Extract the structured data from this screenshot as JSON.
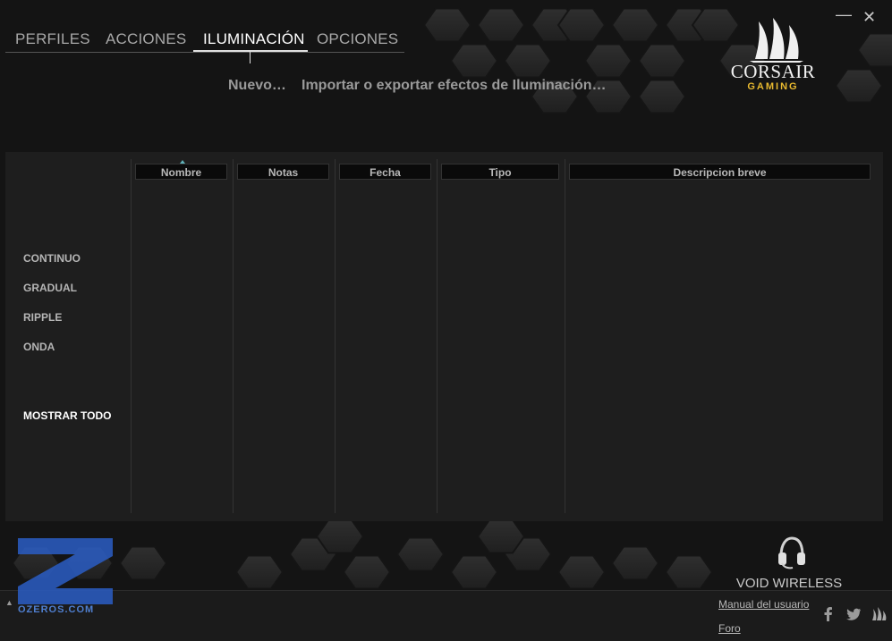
{
  "window": {
    "minimize_glyph": "—",
    "close_glyph": "✕"
  },
  "tabs": [
    {
      "label": "PERFILES",
      "active": false
    },
    {
      "label": "ACCIONES",
      "active": false
    },
    {
      "label": "ILUMINACIÓN",
      "active": true
    },
    {
      "label": "OPCIONES",
      "active": false
    }
  ],
  "actions": {
    "new": "Nuevo…",
    "import_export": "Importar o exportar efectos de Iluminación…"
  },
  "logo": {
    "word": "CORSAIR",
    "sub": "GAMING",
    "sub_color": "#e8b92f"
  },
  "categories": [
    "CONTINUO",
    "GRADUAL",
    "RIPPLE",
    "ONDA"
  ],
  "show_all": "MOSTRAR TODO",
  "table": {
    "columns": [
      "Nombre",
      "Notas",
      "Fecha",
      "Tipo",
      "Descripcion breve"
    ],
    "rows": []
  },
  "watermark": {
    "text": "OZEROS.COM",
    "color": "#2a5dc4"
  },
  "device": {
    "name": "VOID WIRELESS",
    "icon": "headset-icon"
  },
  "footer": {
    "manual": "Manual del usuario",
    "forum": "Foro"
  },
  "social_icons": [
    "facebook-icon",
    "twitter-icon",
    "corsair-sails-icon"
  ]
}
